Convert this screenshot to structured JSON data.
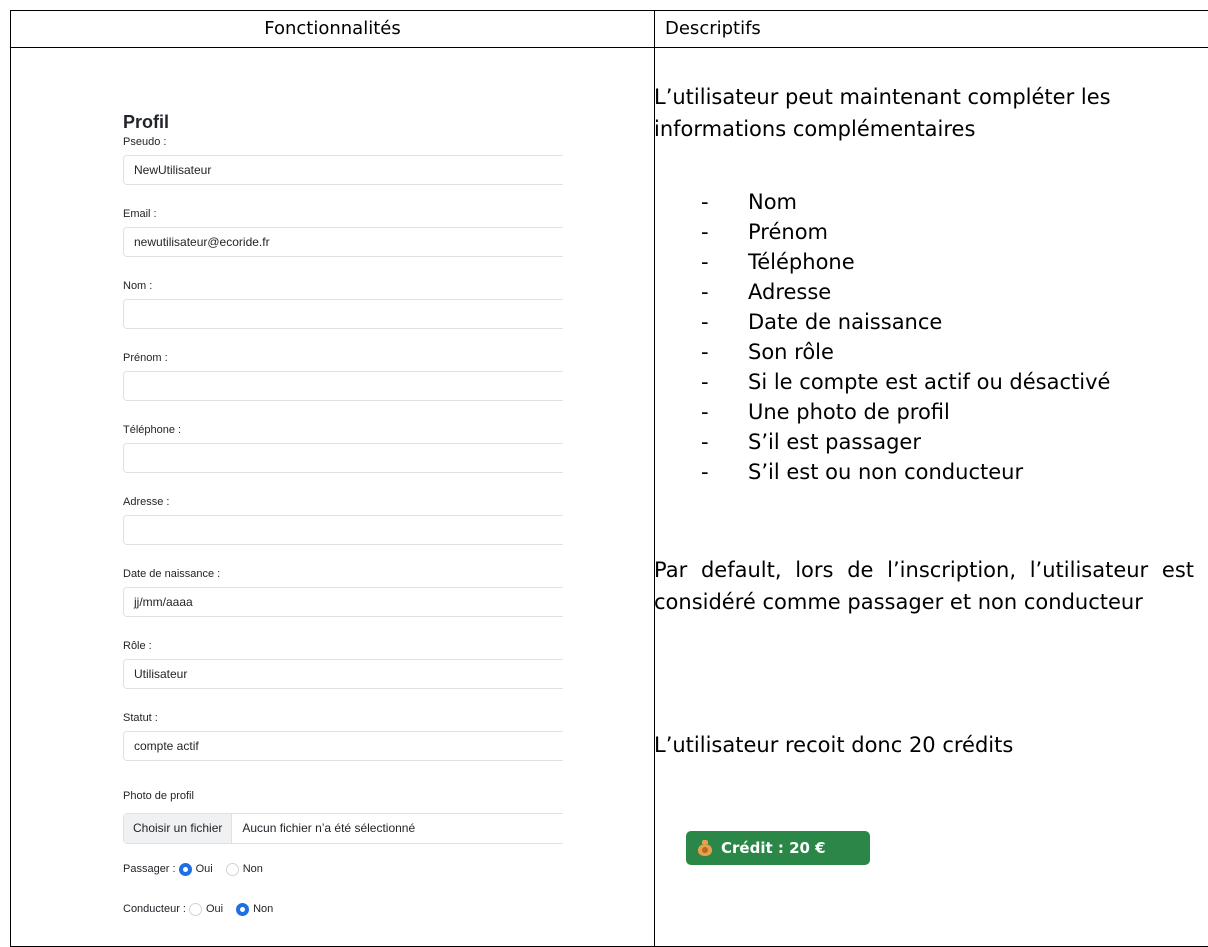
{
  "table": {
    "header_left": "Fonctionnalités",
    "header_right": "Descriptifs"
  },
  "form": {
    "title": "Profil",
    "fields": [
      {
        "label": "Pseudo :",
        "value": "NewUtilisateur"
      },
      {
        "label": "Email :",
        "value": "newutilisateur@ecoride.fr"
      },
      {
        "label": "Nom :",
        "value": ""
      },
      {
        "label": "Prénom :",
        "value": ""
      },
      {
        "label": "Téléphone :",
        "value": ""
      },
      {
        "label": "Adresse :",
        "value": ""
      },
      {
        "label": "Date de naissance :",
        "value": "jj/mm/aaaa"
      },
      {
        "label": "Rôle :",
        "value": "Utilisateur"
      },
      {
        "label": "Statut :",
        "value": "compte actif"
      }
    ],
    "photo": {
      "label": "Photo de profil",
      "button": "Choisir un fichier",
      "filename": "Aucun fichier n’a été sélectionné"
    },
    "passager": {
      "label": "Passager :",
      "yes": "Oui",
      "no": "Non",
      "selected": "Oui"
    },
    "conducteur": {
      "label": "Conducteur :",
      "yes": "Oui",
      "no": "Non",
      "selected": "Non"
    }
  },
  "description": {
    "intro": "L’utilisateur peut maintenant compléter les informations complémentaires",
    "dash": "-",
    "items": [
      "Nom",
      "Prénom",
      "Téléphone",
      "Adresse",
      "Date de naissance",
      "Son rôle",
      "Si le compte est actif ou désactivé",
      "Une photo de profil",
      "S’il est passager",
      "S’il est ou non conducteur"
    ],
    "default_text": "Par default, lors de l’inscription, l’utilisateur est considéré comme passager et non conducteur",
    "credits_text": "L’utilisateur recoit donc 20 crédits",
    "badge": "Crédit : 20 €",
    "colors": {
      "badge_bg": "#2a8747",
      "radio_on": "#1f6fe5"
    },
    "badge_icon": "money-bag-icon"
  }
}
